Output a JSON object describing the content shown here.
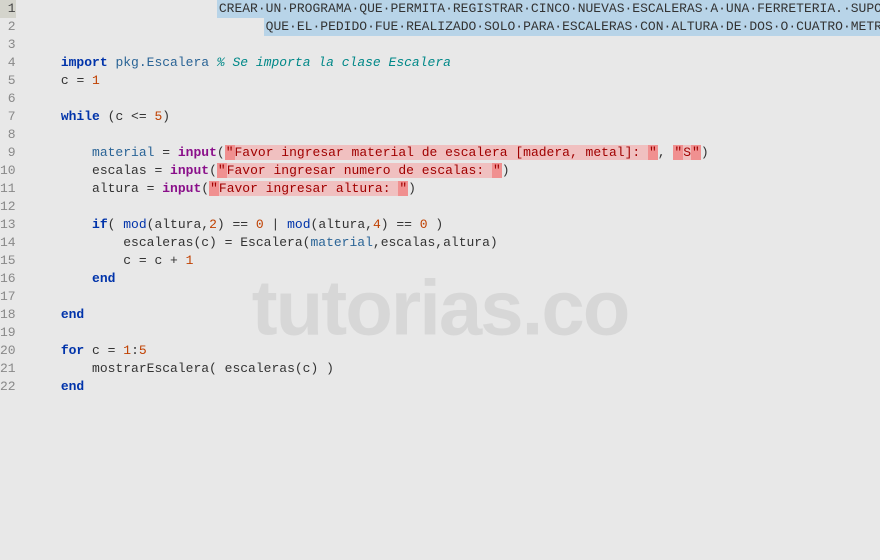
{
  "watermark": "tutorias.co",
  "gutter": {
    "lines": [
      "1",
      "2",
      "3",
      "4",
      "5",
      "6",
      "7",
      "8",
      "9",
      "10",
      "11",
      "12",
      "13",
      "14",
      "15",
      "16",
      "17",
      "18",
      "19",
      "20",
      "21",
      "22"
    ],
    "current": 1
  },
  "code": {
    "l1_pre": "                        ",
    "l1_txt": "CREAR·UN·PROGRAMA·QUE·PERMITA·REGISTRAR·CINCO·NUEVAS·ESCALERAS·A·UNA·FERRETERIA.·SUPONGA",
    "l2_pre": "                              ",
    "l2_txt": "QUE·EL·PEDIDO·FUE·REALIZADO·SOLO·PARA·ESCALERAS·CON·ALTURA·DE·DOS·O·CUATRO·METROS",
    "l4_import": "import",
    "l4_pkg": "pkg.Escalera",
    "l4_comment": "% Se importa la clase Escalera",
    "l5_c": "c",
    "l5_eq": " = ",
    "l5_v": "1",
    "l7_while": "while",
    "l7_cond_open": " (c <= ",
    "l7_cond_num": "5",
    "l7_cond_close": ")",
    "l9_var": "material",
    "l9_eq": " = ",
    "l9_fn": "input",
    "l9_open": "(",
    "l9_q1": "\"",
    "l9_str": "Favor ingresar material de escalera [madera, metal]: ",
    "l9_q2": "\"",
    "l9_comma": ", ",
    "l9_q3": "\"",
    "l9_s": "S",
    "l9_q4": "\"",
    "l9_close": ")",
    "l10_var": "escalas",
    "l10_eq": " = ",
    "l10_fn": "input",
    "l10_open": "(",
    "l10_q1": "\"",
    "l10_str": "Favor ingresar numero de escalas: ",
    "l10_q2": "\"",
    "l10_close": ")",
    "l11_var": "altura",
    "l11_eq": " = ",
    "l11_fn": "input",
    "l11_open": "(",
    "l11_q1": "\"",
    "l11_str": "Favor ingresar altura: ",
    "l11_q2": "\"",
    "l11_close": ")",
    "l13_if": "if",
    "l13_open": "( ",
    "l13_mod1": "mod",
    "l13_m1args": "(altura,",
    "l13_m1num": "2",
    "l13_m1close": ") == ",
    "l13_zero1": "0",
    "l13_or": " | ",
    "l13_mod2": "mod",
    "l13_m2args": "(altura,",
    "l13_m2num": "4",
    "l13_m2close": ") == ",
    "l13_zero2": "0",
    "l13_close": " )",
    "l14_lhs": "escaleras(c) = Escalera(",
    "l14_mat": "material",
    "l14_rest": ",escalas,altura)",
    "l15_c": "c",
    "l15_eq": " = c + ",
    "l15_one": "1",
    "l16_end": "end",
    "l18_end": "end",
    "l20_for": "for",
    "l20_c": " c = ",
    "l20_r1": "1",
    "l20_colon": ":",
    "l20_r2": "5",
    "l21_call": "mostrarEscalera( escaleras(c) )",
    "l22_end": "end"
  }
}
